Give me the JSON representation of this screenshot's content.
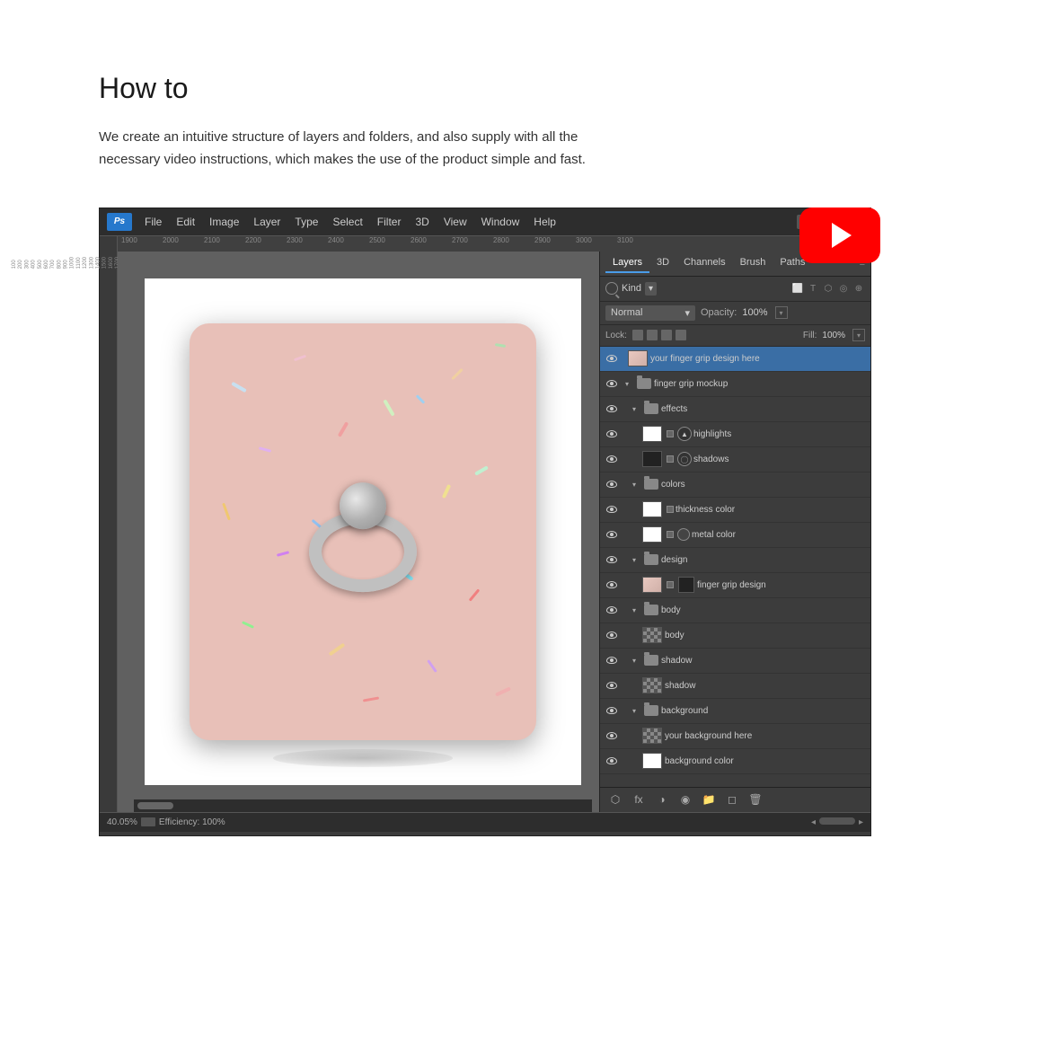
{
  "page": {
    "title": "How to",
    "description": "We create an intuitive structure of layers and folders, and also supply with all the necessary video instructions, which makes the use of the product simple and fast."
  },
  "photoshop": {
    "menu_items": [
      "File",
      "Edit",
      "Image",
      "Layer",
      "Type",
      "Select",
      "Filter",
      "3D",
      "View",
      "Window",
      "Help"
    ],
    "window_title": "Ps",
    "statusbar": {
      "zoom": "40.05%",
      "efficiency": "Efficiency: 100%"
    },
    "panels": {
      "tabs": [
        "Layers",
        "3D",
        "Channels",
        "Brush",
        "Paths"
      ],
      "active_tab": "Layers",
      "kind_label": "Kind",
      "blend_mode": "Normal",
      "opacity_label": "Opacity:",
      "opacity_value": "100%",
      "lock_label": "Lock:",
      "fill_label": "Fill:",
      "fill_value": "100%",
      "layers": [
        {
          "name": "your finger grip design here",
          "type": "layer",
          "indent": 0,
          "visible": true,
          "thumb": "colored",
          "selected": true
        },
        {
          "name": "finger grip mockup",
          "type": "folder",
          "indent": 0,
          "visible": true,
          "expanded": true
        },
        {
          "name": "effects",
          "type": "folder",
          "indent": 1,
          "visible": true,
          "expanded": true
        },
        {
          "name": "highlights",
          "type": "layer",
          "indent": 2,
          "visible": true,
          "thumb": "white",
          "mask": true
        },
        {
          "name": "shadows",
          "type": "layer",
          "indent": 2,
          "visible": true,
          "thumb": "black",
          "mask": true
        },
        {
          "name": "colors",
          "type": "folder",
          "indent": 1,
          "visible": true,
          "expanded": true
        },
        {
          "name": "thickness color",
          "type": "layer",
          "indent": 2,
          "visible": true,
          "thumb": "white"
        },
        {
          "name": "metal color",
          "type": "layer",
          "indent": 2,
          "visible": true,
          "thumb": "white"
        },
        {
          "name": "design",
          "type": "folder",
          "indent": 1,
          "visible": true,
          "expanded": true
        },
        {
          "name": "finger grip design",
          "type": "layer",
          "indent": 2,
          "visible": true,
          "thumb": "colored"
        },
        {
          "name": "body",
          "type": "folder",
          "indent": 1,
          "visible": true,
          "expanded": true
        },
        {
          "name": "body",
          "type": "layer",
          "indent": 2,
          "visible": true,
          "thumb": "checker"
        },
        {
          "name": "shadow",
          "type": "folder",
          "indent": 1,
          "visible": true,
          "expanded": true
        },
        {
          "name": "shadow",
          "type": "layer",
          "indent": 2,
          "visible": true,
          "thumb": "checker"
        },
        {
          "name": "background",
          "type": "folder",
          "indent": 1,
          "visible": true,
          "expanded": true
        },
        {
          "name": "your background here",
          "type": "layer",
          "indent": 2,
          "visible": true,
          "thumb": "checker"
        },
        {
          "name": "background color",
          "type": "layer",
          "indent": 2,
          "visible": true,
          "thumb": "white"
        }
      ],
      "bottom_icons": [
        "link-icon",
        "fx-icon",
        "adjustment-icon",
        "mask-icon",
        "folder-icon",
        "new-layer-icon",
        "trash-icon"
      ]
    }
  }
}
